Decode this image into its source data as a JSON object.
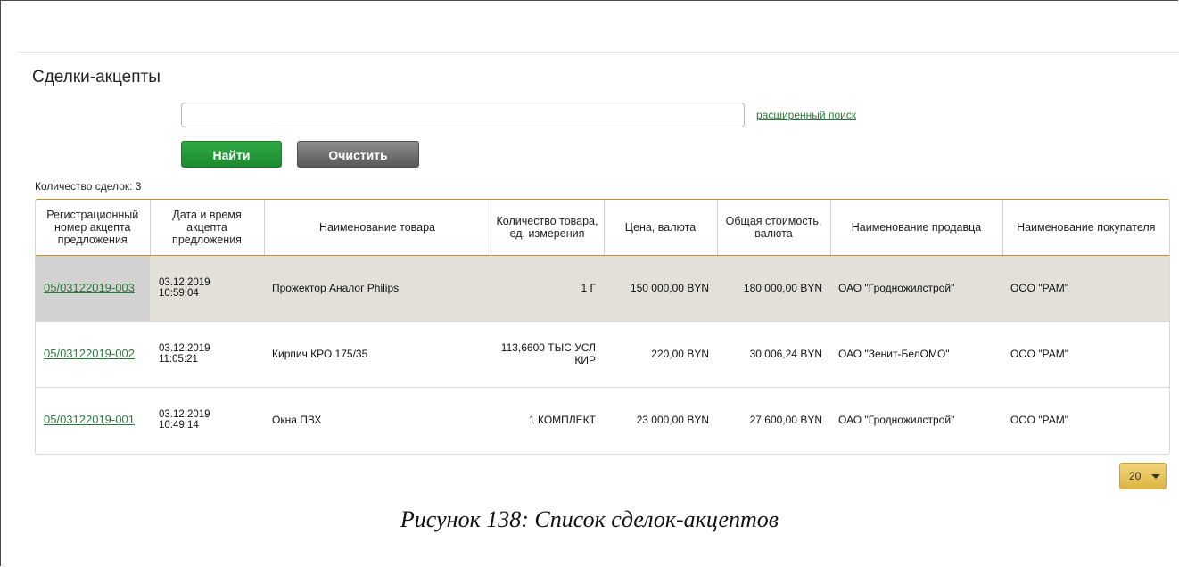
{
  "page_title": "Сделки-акцепты",
  "search": {
    "value": "",
    "placeholder": "",
    "advanced_link": "расширенный поиск"
  },
  "buttons": {
    "find": "Найти",
    "clear": "Очистить"
  },
  "count_label": "Количество сделок: 3",
  "table": {
    "headers": [
      "Регистрационный номер акцепта предложения",
      "Дата и время акцепта предложения",
      "Наименование товара",
      "Количество товара, ед. измерения",
      "Цена, валюта",
      "Общая стоимость, валюта",
      "Наименование продавца",
      "Наименование покупателя"
    ],
    "rows": [
      {
        "reg": "05/03122019-003",
        "date": "03.12.2019",
        "time": "10:59:04",
        "product": "Прожектор Аналог Philips",
        "qty": "1 Г",
        "price": "150 000,00 BYN",
        "total": "180 000,00 BYN",
        "seller": "ОАО \"Гродножилстрой\"",
        "buyer": "ООО \"РАМ\""
      },
      {
        "reg": "05/03122019-002",
        "date": "03.12.2019",
        "time": "11:05:21",
        "product": "Кирпич КРО 175/35",
        "qty": "113,6600 ТЫС УСЛ КИР",
        "price": "220,00 BYN",
        "total": "30 006,24 BYN",
        "seller": "ОАО \"Зенит-БелОМО\"",
        "buyer": "ООО \"РАМ\""
      },
      {
        "reg": "05/03122019-001",
        "date": "03.12.2019",
        "time": "10:49:14",
        "product": "Окна ПВХ",
        "qty": "1 КОМПЛЕКТ",
        "price": "23 000,00 BYN",
        "total": "27 600,00 BYN",
        "seller": "ОАО \"Гродножилстрой\"",
        "buyer": "ООО \"РАМ\""
      }
    ]
  },
  "pager": {
    "page_size": "20"
  },
  "caption": "Рисунок 138: Список сделок-акцептов",
  "colors": {
    "accent_green": "#2b7a3d",
    "find_button": "#1d8a31",
    "clear_button": "#585858",
    "highlight_row": "#e2e0d8",
    "table_border": "#c98e2c",
    "pager": "#ddb443"
  }
}
